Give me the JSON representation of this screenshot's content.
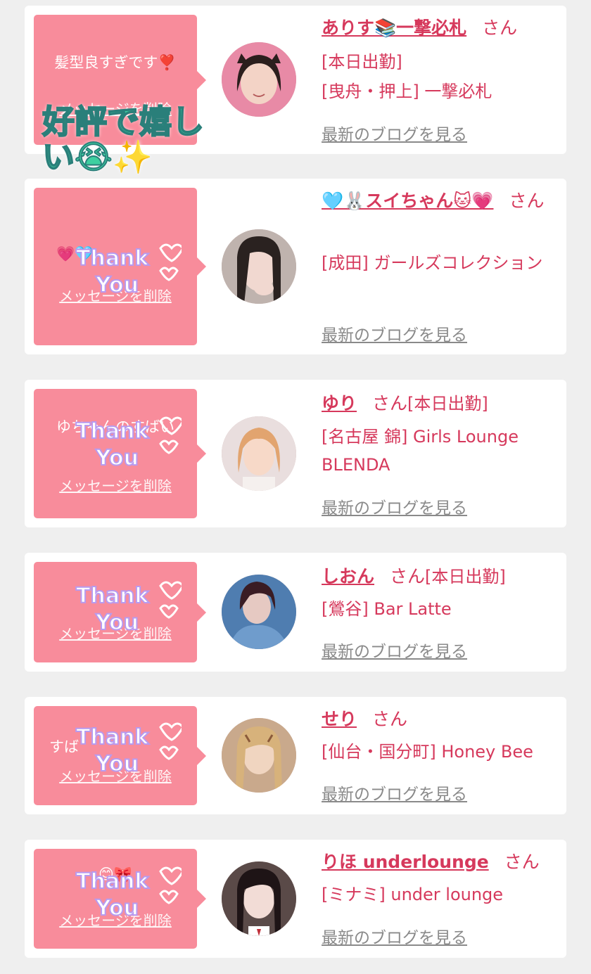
{
  "cards": [
    {
      "message": "髪型良すぎです❣️",
      "delete_label": "メッセージを削除",
      "name": "ありす📚一撃必札",
      "suffix": "さん",
      "status": "[本日出勤]",
      "shop": "[曳舟・押上] 一撃必札",
      "blog_label": "最新のブログを見る",
      "overlay_text": "好評で嬉しい😭✨",
      "colors": {
        "skin": "#f3d3c6",
        "hair": "#2b1e1d",
        "bg": "#e88aa6"
      }
    },
    {
      "message": "💗🩵",
      "delete_label": "メッセージを削除",
      "name": "🩵🐰スイちゃん🐱💗",
      "suffix": "さん",
      "status": "",
      "shop": "[成田] ガールズコレクション",
      "blog_label": "最新のブログを見る",
      "sticker": "thank-you",
      "colors": {
        "skin": "#f1d8d0",
        "hair": "#2a2220",
        "bg": "#bfb3ae"
      }
    },
    {
      "message": "ゆちゃんのすばい",
      "delete_label": "メッセージを削除",
      "name": "ゆり",
      "suffix": "さん",
      "status": "[本日出勤]",
      "shop": "[名古屋 錦] Girls Lounge BLENDA",
      "blog_label": "最新のブログを見る",
      "sticker": "thank-you",
      "colors": {
        "skin": "#f7d9c8",
        "hair": "#e2a46f",
        "bg": "#e9dede"
      }
    },
    {
      "message": "",
      "delete_label": "メッセージを削除",
      "name": "しおん",
      "suffix": "さん",
      "status": "[本日出勤]",
      "shop": "[鶯谷] Bar Latte",
      "blog_label": "最新のブログを見る",
      "sticker": "thank-you",
      "colors": {
        "skin": "#e6c9c2",
        "hair": "#3a1c24",
        "bg": "#4f7db0"
      }
    },
    {
      "message": "すば",
      "delete_label": "メッセージを削除",
      "name": "せり",
      "suffix": "さん",
      "status": "",
      "shop": "[仙台・国分町] Honey Bee",
      "blog_label": "最新のブログを見る",
      "sticker": "thank-you",
      "colors": {
        "skin": "#f0d5c0",
        "hair": "#d7b27b",
        "bg": "#c9a98c"
      }
    },
    {
      "message": "😊🎀",
      "delete_label": "メッセージを削除",
      "name": "りほ underlounge",
      "suffix": "さん",
      "status": "",
      "shop": "[ミナミ] under lounge",
      "blog_label": "最新のブログを見る",
      "sticker": "thank-you",
      "colors": {
        "skin": "#f2dcd6",
        "hair": "#1e1416",
        "bg": "#5a4a48"
      }
    }
  ],
  "sticker_text": {
    "line1": "Thank",
    "line2": "You"
  }
}
